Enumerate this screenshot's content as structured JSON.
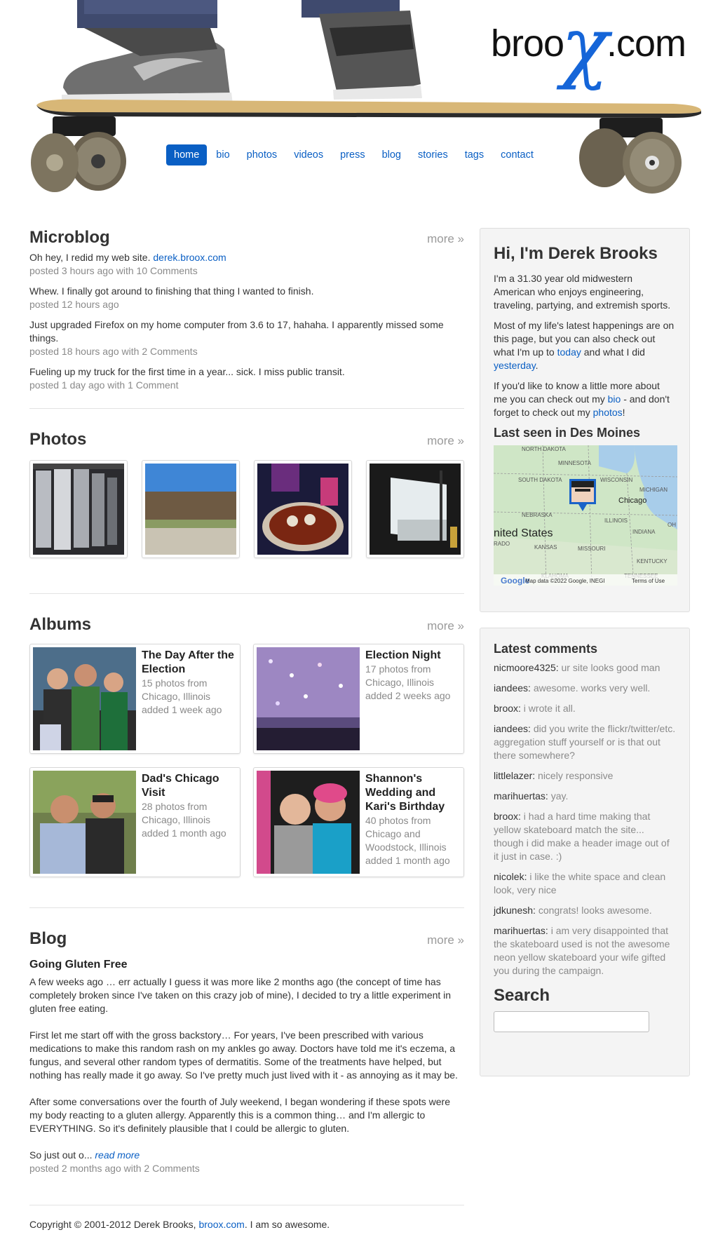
{
  "site": {
    "logo_prefix": "broo",
    "logo_x": "X",
    "logo_suffix": ".com"
  },
  "nav": {
    "items": [
      {
        "label": "home",
        "active": true
      },
      {
        "label": "bio"
      },
      {
        "label": "photos"
      },
      {
        "label": "videos"
      },
      {
        "label": "press"
      },
      {
        "label": "blog"
      },
      {
        "label": "stories"
      },
      {
        "label": "tags"
      },
      {
        "label": "contact"
      }
    ]
  },
  "microblog": {
    "title": "Microblog",
    "more": "more »",
    "items": [
      {
        "text": "Oh hey, I redid my web site. ",
        "link": "derek.broox.com",
        "meta": "posted 3 hours ago with 10 Comments"
      },
      {
        "text": "Whew. I finally got around to finishing that thing I wanted to finish.",
        "meta": "posted 12 hours ago"
      },
      {
        "text": "Just upgraded Firefox on my home computer from 3.6 to 17, hahaha. I apparently missed some things.",
        "meta": "posted 18 hours ago with 2 Comments"
      },
      {
        "text": "Fueling up my truck for the first time in a year... sick. I miss public transit.",
        "meta": "posted 1 day ago with 1 Comment"
      }
    ]
  },
  "photos": {
    "title": "Photos",
    "more": "more »"
  },
  "albums": {
    "title": "Albums",
    "more": "more »",
    "items": [
      {
        "title": "The Day After the Election",
        "count": "15 photos from",
        "place": "Chicago, Illinois",
        "added": "added 1 week ago"
      },
      {
        "title": "Election Night",
        "count": "17 photos from",
        "place": "Chicago, Illinois",
        "added": "added 2 weeks ago"
      },
      {
        "title": "Dad's Chicago Visit",
        "count": "28 photos from",
        "place": "Chicago, Illinois",
        "added": "added 1 month ago"
      },
      {
        "title": "Shannon's Wedding and Kari's Birthday",
        "count": "40 photos from",
        "place": "Chicago and Woodstock, Illinois",
        "added": "added 1 month ago"
      }
    ]
  },
  "blog": {
    "title": "Blog",
    "more": "more »",
    "post_title": "Going Gluten Free",
    "paragraphs": [
      "A few weeks ago … err actually I guess it was more like 2 months ago (the concept of time has completely broken since I've taken on this crazy job of mine), I decided to try a little experiment in gluten free eating.",
      "First let me start off with the gross backstory… For years, I've been prescribed with various medications to make this random rash on my ankles go away. Doctors have told me it's eczema, a fungus, and several other random types of dermatitis. Some of the treatments have helped, but nothing has really made it go away. So I've pretty much just lived with it - as annoying as it may be.",
      "After some conversations over the fourth of July weekend, I began wondering if these spots were my body reacting to a gluten allergy. Apparently this is a common thing… and I'm allergic to EVERYTHING. So it's definitely plausible that I could be allergic to gluten."
    ],
    "excerpt_end": "So just out o... ",
    "read_more": "read more",
    "meta": "posted 2 months ago with 2 Comments"
  },
  "footer": {
    "text_before": "Copyright © 2001-2012 Derek Brooks, ",
    "link": "broox.com",
    "text_after": ". I am so awesome."
  },
  "about": {
    "title": "Hi, I'm Derek Brooks",
    "p1": "I'm a 31.30 year old midwestern American who enjoys engineering, traveling, partying, and extremish sports.",
    "p2_a": "Most of my life's latest happenings are on this page, but you can also check out what I'm up to ",
    "p2_link1": "today",
    "p2_b": " and what I did ",
    "p2_link2": "yesterday",
    "p2_c": ".",
    "p3_a": "If you'd like to know a little more about me you can check out my ",
    "p3_link1": "bio",
    "p3_b": " - and don't forget to check out my ",
    "p3_link2": "photos",
    "p3_c": "!",
    "last_seen": "Last seen in Des Moines",
    "map_labels": {
      "north_dakota": "NORTH DAKOTA",
      "minnesota": "MINNESOTA",
      "south_dakota": "SOUTH DAKOTA",
      "wisconsin": "WISCONSIN",
      "michigan": "MICHIGAN",
      "chicago": "Chicago",
      "nebraska": "NEBRASKA",
      "illinois": "ILLINOIS",
      "united_states": "nited States",
      "indiana": "INDIANA",
      "oh": "OH",
      "rado": "RADO",
      "kansas": "KANSAS",
      "missouri": "MISSOURI",
      "kentucky": "KENTUCKY",
      "oklahoma": "KLAHOMA",
      "tennessee": "TENNESSEE",
      "google": "Google",
      "map_data": "Map data ©2022 Google, INEGI",
      "terms": "Terms of Use"
    }
  },
  "comments": {
    "title": "Latest comments",
    "items": [
      {
        "user": "nicmoore4325:",
        "text": " ur site looks good man"
      },
      {
        "user": "iandees:",
        "text": " awesome. works very well."
      },
      {
        "user": "broox:",
        "text": " i wrote it all."
      },
      {
        "user": "iandees:",
        "text": " did you write the flickr/twitter/etc. aggregation stuff yourself or is that out there somewhere?"
      },
      {
        "user": "littlelazer:",
        "text": " nicely responsive"
      },
      {
        "user": "marihuertas:",
        "text": " yay."
      },
      {
        "user": "broox:",
        "text": " i had a hard time making that yellow skateboard match the site... though i did make a header image out of it just in case. :)"
      },
      {
        "user": "nicolek:",
        "text": " i like the white space and clean look, very nice"
      },
      {
        "user": "jdkunesh:",
        "text": " congrats! looks awesome."
      },
      {
        "user": "marihuertas:",
        "text": " i am very disappointed that the skateboard used is not the awesome neon yellow skateboard your wife gifted you during the campaign."
      }
    ],
    "search_title": "Search"
  },
  "colors": {
    "link": "#0a5fc4",
    "accent_logo": "#1565d8",
    "sidebar_bg": "#f4f4f4",
    "meta_text": "#8a8a8a"
  }
}
